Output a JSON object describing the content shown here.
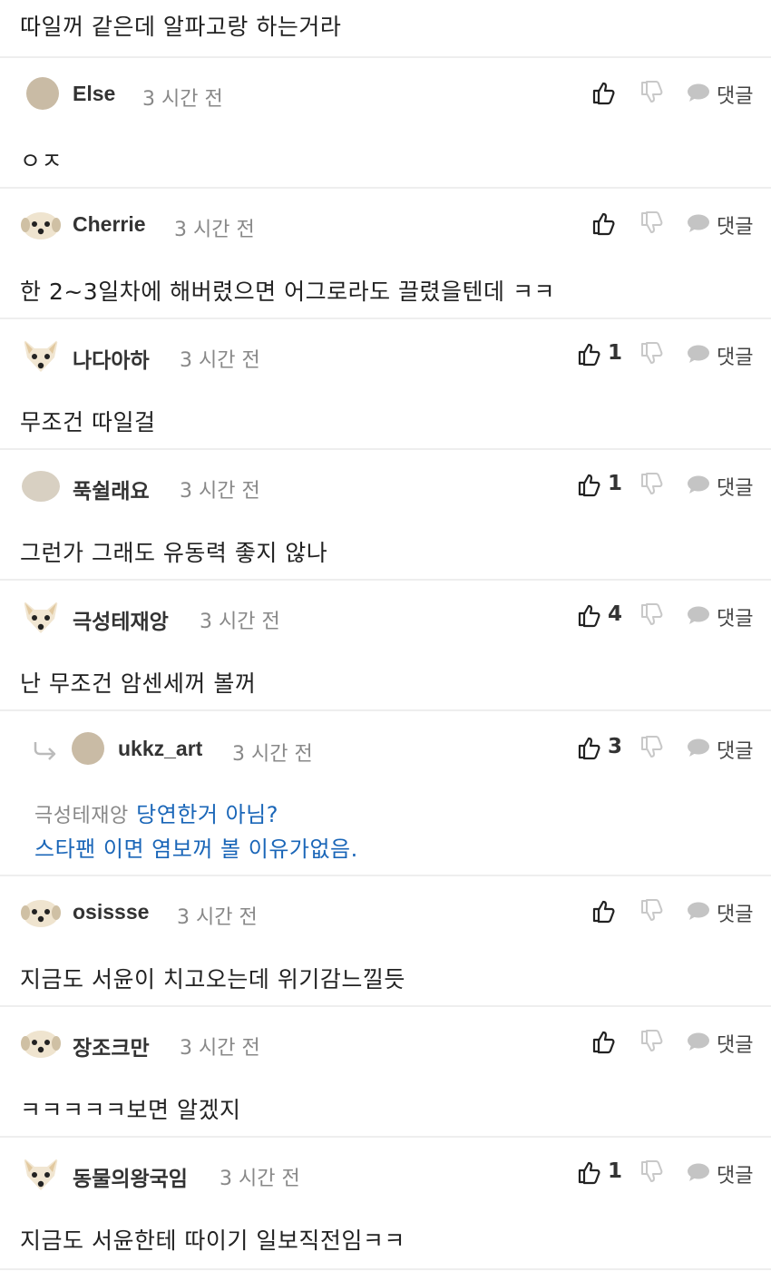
{
  "top_text": "따일꺼 같은데 알파고랑 하는거라",
  "action_reply_label": "댓글",
  "comments": [
    {
      "author": "Else",
      "time": "3 시간 전",
      "likes": "",
      "text": "ㅇㅈ",
      "avatar": "plain"
    },
    {
      "author": "Cherrie",
      "time": "3 시간 전",
      "likes": "",
      "text": "한 2~3일차에 해버렸으면 어그로라도 끌렸을텐데 ㅋㅋ",
      "avatar": "dog"
    },
    {
      "author": "나다아하",
      "time": "3 시간 전",
      "likes": "1",
      "text": "무조건 따일걸",
      "avatar": "fox"
    },
    {
      "author": "푹쉴래요",
      "time": "3 시간 전",
      "likes": "1",
      "text": "그런가 그래도 유동력 좋지 않나",
      "avatar": "plain-light"
    },
    {
      "author": "극성테재앙",
      "time": "3 시간 전",
      "likes": "4",
      "text": "난 무조건 암센세꺼 볼꺼",
      "avatar": "fox"
    }
  ],
  "reply": {
    "author": "ukkz_art",
    "time": "3 시간 전",
    "likes": "3",
    "mention": "극성테재앙",
    "line1": "당연한거 아님?",
    "line2": "스타팬 이면 염보꺼 볼 이유가없음."
  },
  "comments2": [
    {
      "author": "osissse",
      "time": "3 시간 전",
      "likes": "",
      "text": "지금도 서윤이 치고오는데 위기감느낄듯",
      "avatar": "dog"
    },
    {
      "author": "장조크만",
      "time": "3 시간 전",
      "likes": "",
      "text": "ㅋㅋㅋㅋㅋ보면 알겠지",
      "avatar": "dog"
    },
    {
      "author": "동물의왕국임",
      "time": "3 시간 전",
      "likes": "1",
      "text": "지금도 서윤한테 따이기 일보직전임ㅋㅋ",
      "avatar": "fox"
    }
  ],
  "icons": {
    "like": "thumbs-up-icon",
    "dislike": "thumbs-down-icon",
    "reply": "speech-bubble-icon",
    "reply_arrow": "reply-arrow-icon"
  },
  "colors": {
    "reply_text": "#1a66b8",
    "divider": "#eeeeee"
  }
}
